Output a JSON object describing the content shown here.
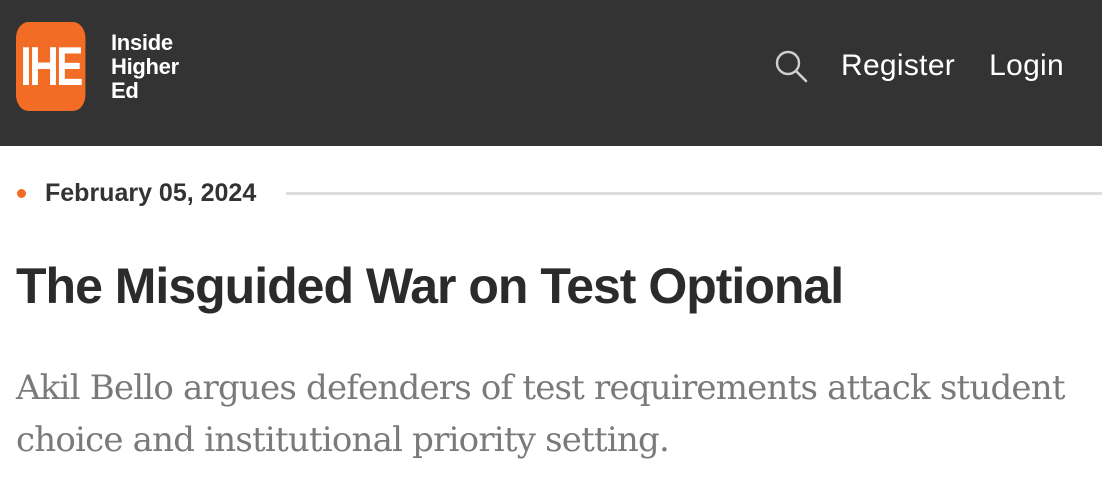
{
  "header": {
    "logo": {
      "mark": "IHE",
      "words": [
        "Inside",
        "Higher",
        "Ed"
      ]
    },
    "search_icon": "search-icon",
    "nav": {
      "register_label": "Register",
      "login_label": "Login"
    }
  },
  "article": {
    "date": "February 05, 2024",
    "title": "The Misguided War on Test Optional",
    "dek": "Akil Bello argues defenders of test requirements attack student choice and institutional priority setting."
  },
  "colors": {
    "header_bg": "#333333",
    "brand_orange": "#f26c25",
    "headline": "#2b2b2b",
    "dek": "#7a7a7a"
  }
}
